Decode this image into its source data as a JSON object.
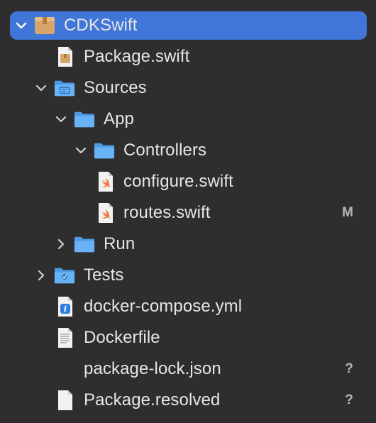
{
  "tree": {
    "root": {
      "label": "CDKSwift",
      "icon": "package-box-icon",
      "expanded": true
    },
    "items": [
      {
        "label": "Package.swift",
        "icon": "swift-package-file-icon"
      },
      {
        "label": "Sources",
        "icon": "sources-folder-icon",
        "expanded": true
      },
      {
        "label": "App",
        "icon": "folder-icon",
        "expanded": true
      },
      {
        "label": "Controllers",
        "icon": "folder-icon",
        "expanded": true
      },
      {
        "label": "configure.swift",
        "icon": "swift-file-icon"
      },
      {
        "label": "routes.swift",
        "icon": "swift-file-icon",
        "badge": "M"
      },
      {
        "label": "Run",
        "icon": "folder-icon",
        "expanded": false
      },
      {
        "label": "Tests",
        "icon": "tests-folder-icon",
        "expanded": false
      },
      {
        "label": "docker-compose.yml",
        "icon": "info-file-icon"
      },
      {
        "label": "Dockerfile",
        "icon": "text-file-icon"
      },
      {
        "label": "package-lock.json",
        "icon": "",
        "badge": "?"
      },
      {
        "label": "Package.resolved",
        "icon": "blank-file-icon",
        "badge": "?"
      }
    ]
  },
  "colors": {
    "background": "#2e2e2f",
    "selection": "#3f76d7",
    "text": "#e6e6e6",
    "badge": "#b6b6b6",
    "folder": "#5aa8f0",
    "package": "#d8a66a",
    "swift": "#f07b3f"
  }
}
